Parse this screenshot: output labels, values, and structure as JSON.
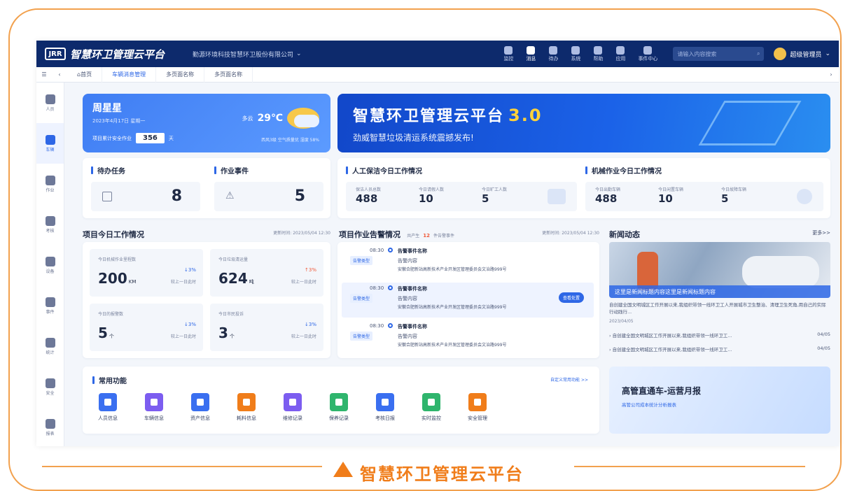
{
  "app": {
    "logo_mark": "JRR",
    "title": "智慧环卫管理云平台",
    "company": "勤源环境科技智慧环卫股份有限公司"
  },
  "topbar": {
    "icons": [
      {
        "icon": "monitor-icon",
        "label": "监控"
      },
      {
        "icon": "bell-icon",
        "label": "消息"
      },
      {
        "icon": "send-icon",
        "label": "待办"
      },
      {
        "icon": "globe-icon",
        "label": "系统"
      },
      {
        "icon": "user-icon",
        "label": "帮助"
      },
      {
        "icon": "building-icon",
        "label": "应用"
      },
      {
        "icon": "clipboard-icon",
        "label": "事件中心"
      }
    ],
    "search_placeholder": "请输入内容搜索",
    "user_name": "超级管理员"
  },
  "tabs": [
    "首页",
    "车辆消息管理",
    "多页面名称",
    "多页面名称"
  ],
  "sidebar": [
    "人员",
    "车辆",
    "作业",
    "考核",
    "设备",
    "事件",
    "统计",
    "安全",
    "报表"
  ],
  "weather": {
    "name": "周星星",
    "date": "2023年4月17日 星期一",
    "safe_label": "项目累计安全作业",
    "safe_days": "356",
    "safe_unit": "天",
    "condition": "多云",
    "temp": "29℃",
    "air": "西风3级  空气质量优  湿度 58%"
  },
  "banner": {
    "title": "智慧环卫管理云平台",
    "version": "3.0",
    "subtitle": "劲威智慧垃圾清运系统震撼发布!"
  },
  "todo": {
    "title": "待办任务",
    "value": "8"
  },
  "events": {
    "title": "作业事件",
    "value": "5"
  },
  "manual": {
    "title": "人工保洁今日工作情况",
    "stats": [
      {
        "label": "保洁人员总数",
        "value": "488"
      },
      {
        "label": "今日请假人数",
        "value": "10"
      },
      {
        "label": "今日旷工人数",
        "value": "5"
      }
    ]
  },
  "machine": {
    "title": "机械作业今日工作情况",
    "stats": [
      {
        "label": "今日出勤车辆",
        "value": "488"
      },
      {
        "label": "今日闲置车辆",
        "value": "10"
      },
      {
        "label": "今日故障车辆",
        "value": "5"
      }
    ]
  },
  "project": {
    "title": "项目今日工作情况",
    "updated": "更新时间: 2023/05/04  12:30",
    "cells": [
      {
        "label": "今日机械作业里程数",
        "value": "200",
        "unit": "KM",
        "change": "↓3%",
        "compare": "较上一日此时"
      },
      {
        "label": "今日垃圾清运量",
        "value": "624",
        "unit": "吨",
        "change": "↑3%",
        "compare": "较上一日此时"
      },
      {
        "label": "今日的报警数",
        "value": "5",
        "unit": "个",
        "change": "↓3%",
        "compare": "较上一日此时"
      },
      {
        "label": "今日市民投诉",
        "value": "3",
        "unit": "个",
        "change": "↓3%",
        "compare": "较上一日此时"
      }
    ]
  },
  "alarms": {
    "title": "项目作业告警情况",
    "sub_prefix": "共产生",
    "count": "12",
    "sub_suffix": "件告警事件",
    "updated": "更新时间: 2023/05/04  12:30",
    "items": [
      {
        "time": "08:30",
        "name": "告警事件名称",
        "tag": "告警类型",
        "content": "告警内容",
        "address": "安徽合肥新站高新技术产业开发区管理委员会文治路999号"
      },
      {
        "time": "08:30",
        "name": "告警事件名称",
        "tag": "告警类型",
        "content": "告警内容",
        "address": "安徽合肥新站高新技术产业开发区管理委员会文治路999号",
        "action": "查看处置"
      },
      {
        "time": "08:30",
        "name": "告警事件名称",
        "tag": "告警类型",
        "content": "告警内容",
        "address": "安徽合肥新站高新技术产业开发区管理委员会文治路999号"
      }
    ]
  },
  "news": {
    "title": "新闻动态",
    "more": "更多>>",
    "image_caption": "这里是新闻标题内容这里是新闻标题内容",
    "summary": "自创建全国文明城区工作开展以来,我组织带领一线环卫工人开展城市卫生整治、清理卫生死角,用自己的实际行动践行...",
    "date": "2023/04/05",
    "list": [
      {
        "text": "自创建全国文明城区工作开展以来,我组织带领一线环卫工...",
        "date": "04/05"
      },
      {
        "text": "自创建全国文明城区工作开展以来,我组织带领一线环卫工...",
        "date": "04/05"
      }
    ]
  },
  "functions": {
    "title": "常用功能",
    "custom": "自定义常用功能 >>",
    "items": [
      {
        "label": "人员信息",
        "color": "#3a6ff0",
        "icon": "person-icon"
      },
      {
        "label": "车辆信息",
        "color": "#7c5df0",
        "icon": "truck-icon"
      },
      {
        "label": "资产信息",
        "color": "#3a6ff0",
        "icon": "monitor-icon"
      },
      {
        "label": "耗料信息",
        "color": "#f07d1a",
        "icon": "fuel-icon"
      },
      {
        "label": "维修记录",
        "color": "#7c5df0",
        "icon": "wrench-icon"
      },
      {
        "label": "保养记录",
        "color": "#2fb56d",
        "icon": "doc-icon"
      },
      {
        "label": "考核日报",
        "color": "#3a6ff0",
        "icon": "calendar-icon"
      },
      {
        "label": "实时监控",
        "color": "#2fb56d",
        "icon": "camera-icon"
      },
      {
        "label": "安全管理",
        "color": "#f07d1a",
        "icon": "shield-icon"
      }
    ]
  },
  "report": {
    "title": "高管直通车-运营月报",
    "subtitle": "高管公司成本统计分析报表"
  },
  "caption": "智慧环卫管理云平台"
}
